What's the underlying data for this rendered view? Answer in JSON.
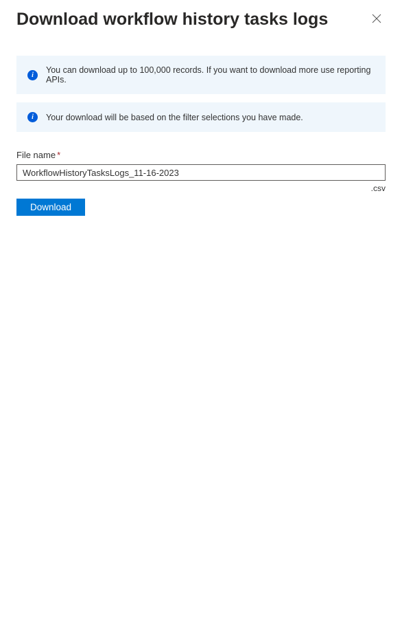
{
  "header": {
    "title": "Download workflow history tasks logs"
  },
  "banners": {
    "info1": "You can download up to 100,000 records. If you want to download more use reporting APIs.",
    "info2": "Your download will be based on the filter selections you have made."
  },
  "form": {
    "filename_label": "File name",
    "filename_value": "WorkflowHistoryTasksLogs_11-16-2023",
    "extension": ".csv",
    "download_button": "Download"
  }
}
